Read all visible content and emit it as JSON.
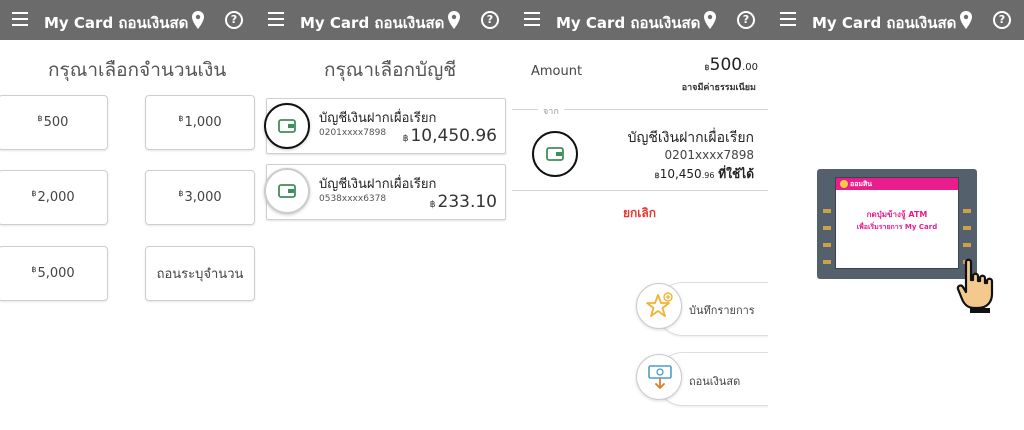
{
  "app": {
    "title": "My Card ถอนเงินสด",
    "help_symbol": "?"
  },
  "currency_symbol": "฿",
  "panel1": {
    "heading": "กรุณาเลือกจำนวนเงิน",
    "amounts": [
      {
        "value": "500"
      },
      {
        "value": "1,000"
      },
      {
        "value": "2,000"
      },
      {
        "value": "3,000"
      },
      {
        "value": "5,000"
      }
    ],
    "custom_label": "ถอนระบุจำนวน"
  },
  "panel2": {
    "heading": "กรุณาเลือกบัญชี",
    "accounts": [
      {
        "name": "บัญชีเงินฝากเผื่อเรียก",
        "number": "0201xxxx7898",
        "balance": "10,450.96"
      },
      {
        "name": "บัญชีเงินฝากเผื่อเรียก",
        "number": "0538xxxx6378",
        "balance": "233.10"
      }
    ]
  },
  "panel3": {
    "amount_label": "Amount",
    "amount_main": "500",
    "amount_decimals": ".00",
    "fee_note": "อาจมีค่าธรรมเนียม",
    "from_label": "จาก",
    "account_name": "บัญชีเงินฝากเผื่อเรียก",
    "account_number": "0201xxxx7898",
    "available_main": "10,450",
    "available_decimals": ".96",
    "available_suffix": "ที่ใช้ได้",
    "cancel_label": "ยกเลิก",
    "actions": [
      {
        "label": "บันทึกรายการ"
      },
      {
        "label": "ถอนเงินสด"
      }
    ]
  },
  "panel4": {
    "bank_logo_text": "ออมสิน",
    "instruction_line1": "กดปุ่มข้างจู้ ATM",
    "instruction_line2": "เพื่อเริ่มรายการ My Card"
  },
  "colors": {
    "topbar": "#6b6b6b",
    "cancel": "#e53935",
    "atm_pink": "#e91e8c",
    "star_gold": "#f2b233",
    "wallet_green": "#3f8f5a"
  }
}
